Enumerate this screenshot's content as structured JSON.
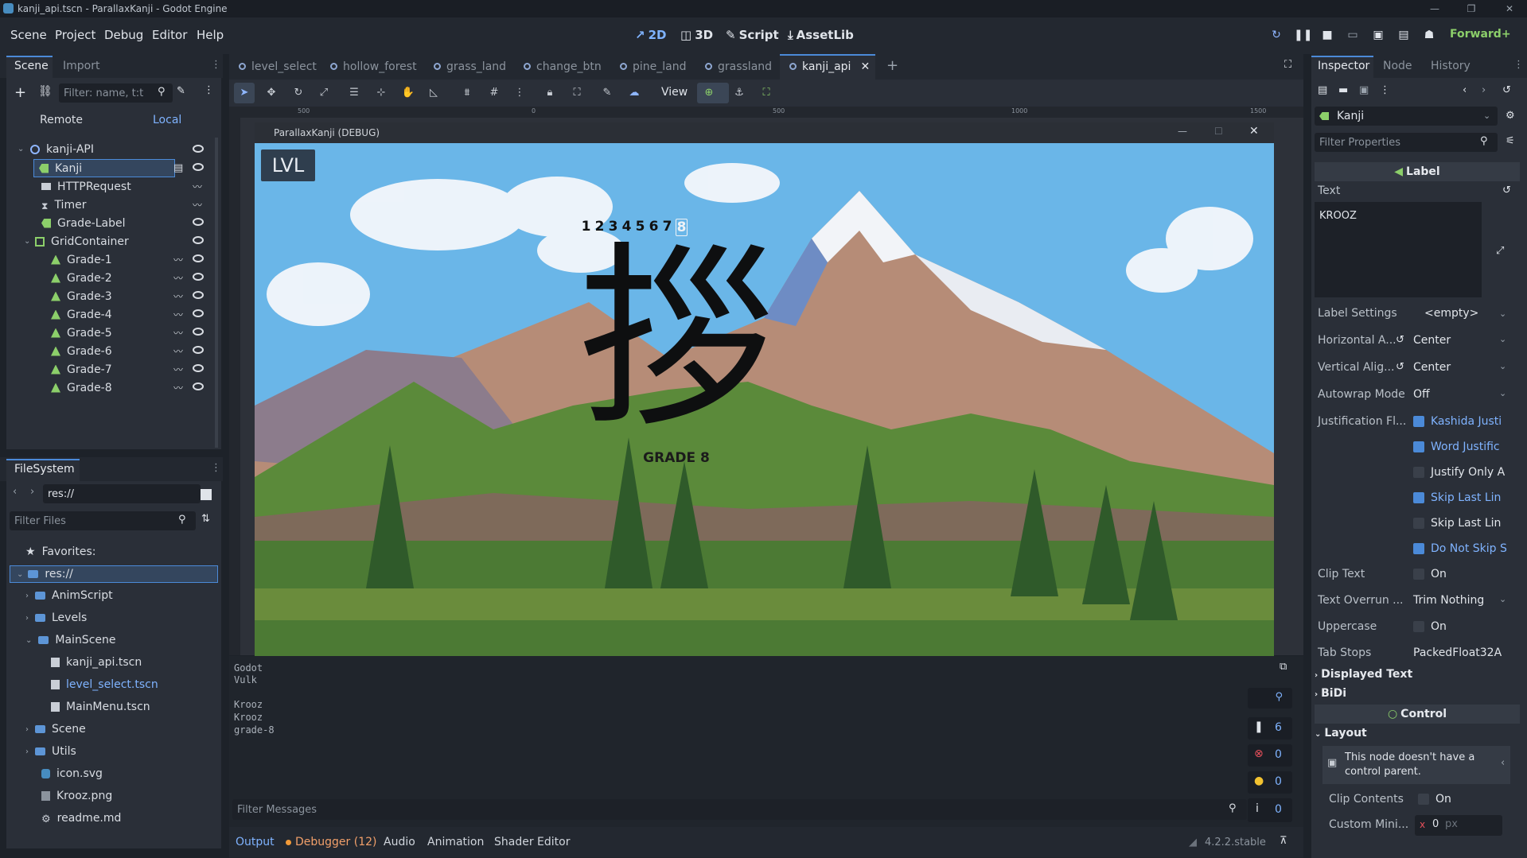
{
  "window": {
    "title": "kanji_api.tscn - ParallaxKanji - Godot Engine"
  },
  "menu": {
    "items": [
      "Scene",
      "Project",
      "Debug",
      "Editor",
      "Help"
    ]
  },
  "modes": {
    "m2d": "2D",
    "m3d": "3D",
    "script": "Script",
    "assetlib": "AssetLib"
  },
  "renderer": "Forward+",
  "scene_dock": {
    "tabs": {
      "scene": "Scene",
      "import": "Import"
    },
    "filter_placeholder": "Filter: name, t:t",
    "remote": "Remote",
    "local": "Local",
    "nodes": [
      "kanji-API",
      "Kanji",
      "HTTPRequest",
      "Timer",
      "Grade-Label",
      "GridContainer",
      "Grade-1",
      "Grade-2",
      "Grade-3",
      "Grade-4",
      "Grade-5",
      "Grade-6",
      "Grade-7",
      "Grade-8"
    ]
  },
  "filesystem": {
    "title": "FileSystem",
    "path": "res://",
    "filter_placeholder": "Filter Files",
    "favorites": "Favorites:",
    "items": [
      "res://",
      "AnimScript",
      "Levels",
      "MainScene",
      "kanji_api.tscn",
      "level_select.tscn",
      "MainMenu.tscn",
      "Scene",
      "Utils",
      "icon.svg",
      "Krooz.png",
      "readme.md"
    ]
  },
  "scene_tabs": [
    "level_select",
    "hollow_forest",
    "grass_land",
    "change_btn",
    "pine_land",
    "grassland",
    "kanji_api"
  ],
  "view_label": "View",
  "ruler": [
    "500",
    "0",
    "500",
    "1000",
    "1500"
  ],
  "game_window": {
    "title": "ParallaxKanji  (DEBUG)",
    "lvl_button": "LVL",
    "grades": [
      "1",
      "2",
      "3",
      "4",
      "5",
      "6",
      "7",
      "8"
    ],
    "kanji": "拶",
    "grade_label": "GRADE 8"
  },
  "output": {
    "lines": [
      "Godot",
      "Vulk",
      "",
      "Krooz",
      "Krooz",
      "grade-8"
    ],
    "filter_placeholder": "Filter Messages",
    "counts": [
      "6",
      "0",
      "0",
      "0"
    ],
    "tabs": {
      "output": "Output",
      "debugger": "Debugger (12)",
      "audio": "Audio",
      "animation": "Animation",
      "shader": "Shader Editor"
    },
    "version": "4.2.2.stable"
  },
  "inspector": {
    "tabs": {
      "inspector": "Inspector",
      "node": "Node",
      "history": "History"
    },
    "node_name": "Kanji",
    "filter_placeholder": "Filter Properties",
    "label_section": "Label",
    "text_label": "Text",
    "text_value": "KROOZ",
    "props": {
      "label_settings": "Label Settings",
      "label_settings_val": "<empty>",
      "h_align": "Horizontal A...",
      "h_align_val": "Center",
      "v_align": "Vertical Alig...",
      "v_align_val": "Center",
      "autowrap": "Autowrap Mode",
      "autowrap_val": "Off",
      "justification": "Justification Fl...",
      "just_opts": [
        "Kashida Justi",
        "Word Justific",
        "Justify Only A",
        "Skip Last Lin",
        "Skip Last Lin",
        "Do Not Skip S"
      ],
      "clip_text": "Clip Text",
      "on": "On",
      "overrun": "Text Overrun ...",
      "overrun_val": "Trim Nothing",
      "uppercase": "Uppercase",
      "tab_stops": "Tab Stops",
      "tab_stops_val": "PackedFloat32A",
      "displayed_text": "Displayed Text",
      "bidi": "BiDi"
    },
    "control_section": "Control",
    "layout": "Layout",
    "warning": "This node doesn't have a control parent.",
    "clip_contents": "Clip Contents",
    "custom_min": "Custom Mini...",
    "custom_min_x": "x",
    "custom_min_val": "0",
    "px": "px"
  },
  "colors": {
    "accent": "#4b8ad8",
    "bg": "#1d2229",
    "panel": "#2a2f38"
  }
}
